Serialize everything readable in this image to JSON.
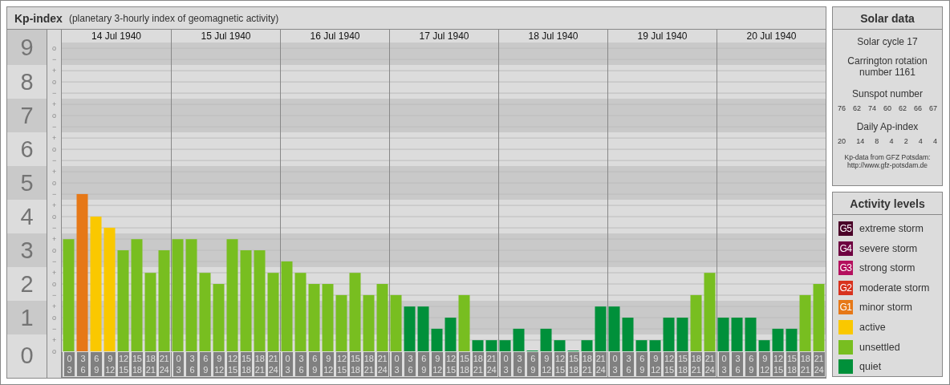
{
  "kp_panel": {
    "title": "Kp-index",
    "subtitle": "(planetary 3-hourly index of geomagnetic activity)",
    "days": [
      "14 Jul 1940",
      "15 Jul 1940",
      "16 Jul 1940",
      "17 Jul 1940",
      "18 Jul 1940",
      "19 Jul 1940",
      "20 Jul 1940"
    ],
    "sub_marks": [
      "o",
      "−",
      "+",
      "o",
      "−",
      "+",
      "o",
      "−",
      "+",
      "o",
      "−",
      "+",
      "o",
      "−",
      "+",
      "o",
      "−",
      "+",
      "o",
      "−",
      "+",
      "o",
      "−",
      "+",
      "o",
      "−",
      "+",
      "o"
    ],
    "chart_data": {
      "type": "bar",
      "ylim": [
        0,
        9.17
      ],
      "grid": true,
      "yticks": [
        {
          "value": 9,
          "label": "9"
        },
        {
          "value": 8,
          "label": "8"
        },
        {
          "value": 7,
          "label": "7"
        },
        {
          "value": 6,
          "label": "6"
        },
        {
          "value": 5,
          "label": "5"
        },
        {
          "value": 4,
          "label": "4"
        },
        {
          "value": 3,
          "label": "3"
        },
        {
          "value": 2,
          "label": "2"
        },
        {
          "value": 1,
          "label": "1"
        },
        {
          "value": 0,
          "label": "0"
        }
      ],
      "categories": [
        "0 3",
        "3 6",
        "6 9",
        "9 12",
        "12 15",
        "15 18",
        "18 21",
        "21 24",
        "0 3",
        "3 6",
        "6 9",
        "9 12",
        "12 15",
        "15 18",
        "18 21",
        "21 24",
        "0 3",
        "3 6",
        "6 9",
        "9 12",
        "12 15",
        "15 18",
        "18 21",
        "21 24",
        "0 3",
        "3 6",
        "6 9",
        "9 12",
        "12 15",
        "15 18",
        "18 21",
        "21 24",
        "0 3",
        "3 6",
        "6 9",
        "9 12",
        "12 15",
        "15 18",
        "18 21",
        "21 24",
        "0 3",
        "3 6",
        "6 9",
        "9 12",
        "12 15",
        "15 18",
        "18 21",
        "21 24",
        "0 3",
        "3 6",
        "6 9",
        "9 12",
        "12 15",
        "15 18",
        "18 21",
        "21 24"
      ],
      "values": [
        3.33,
        4.67,
        4,
        3.67,
        3,
        3.33,
        2.33,
        3,
        3.33,
        3.33,
        2.33,
        2,
        3.33,
        3,
        3,
        2.33,
        2.67,
        2.33,
        2,
        2,
        1.67,
        2.33,
        1.67,
        2,
        1.67,
        1.33,
        1.33,
        0.67,
        1,
        1.67,
        0.33,
        0.33,
        0.33,
        0.67,
        0,
        0.67,
        0.33,
        0,
        0.33,
        1.33,
        1.33,
        1,
        0.33,
        0.33,
        1,
        1,
        1.67,
        2.33,
        1,
        1,
        1,
        0.33,
        0.67,
        0.67,
        1.67,
        2
      ]
    }
  },
  "solar_panel": {
    "title": "Solar data",
    "cycle": "Solar cycle 17",
    "carrington": "Carrington rotation number 1161",
    "sunspot_heading": "Sunspot number",
    "sunspot_numbers": [
      "76",
      "62",
      "74",
      "60",
      "62",
      "66",
      "67"
    ],
    "ap_heading": "Daily Ap-index",
    "ap_values": [
      "20",
      "14",
      "8",
      "4",
      "2",
      "4",
      "4"
    ],
    "source_lines": [
      "Kp-data from GFZ Potsdam:",
      "http://www.gfz-potsdam.de"
    ]
  },
  "legend_panel": {
    "title": "Activity levels",
    "items": [
      {
        "badge": "G5",
        "label": "extreme storm",
        "color": "#4a0028"
      },
      {
        "badge": "G4",
        "label": "severe storm",
        "color": "#6e0040"
      },
      {
        "badge": "G3",
        "label": "strong storm",
        "color": "#b4105e"
      },
      {
        "badge": "G2",
        "label": "moderate storm",
        "color": "#d8321e"
      },
      {
        "badge": "G1",
        "label": "minor storm",
        "color": "#e67817"
      },
      {
        "label": "active",
        "color": "#fac800"
      },
      {
        "label": "unsettled",
        "color": "#78be20"
      },
      {
        "label": "quiet",
        "color": "#00903a"
      }
    ]
  }
}
